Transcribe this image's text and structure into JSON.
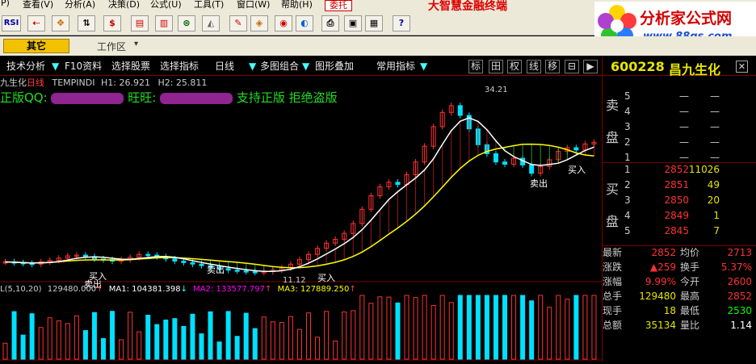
{
  "menu": {
    "items": [
      "P)",
      "查看(V)",
      "分析(A)",
      "决策(D)",
      "公式(U)",
      "工具(T)",
      "窗口(W)",
      "帮助(H)"
    ],
    "trust": "委托",
    "brand": "大智慧金融终端"
  },
  "logo": {
    "title": "分析家公式网",
    "url": "www.88gs.com"
  },
  "toolbar": {
    "rsi": "RSI",
    "dollar": "$"
  },
  "tabstrip": {
    "other": "其它",
    "workspace": "工作区"
  },
  "chart_toolbar": {
    "items": [
      "技术分析",
      "F10资料",
      "选择股票",
      "选择指标",
      "日线",
      "多图组合",
      "图形叠加",
      "常用指标"
    ],
    "toggles": [
      "标",
      "田",
      "权",
      "线",
      "移",
      "⊟",
      "▶"
    ]
  },
  "price_chart": {
    "name": "九生化",
    "period": "日线",
    "indicator": "TEMPINDI",
    "h1": "H1: 26.921",
    "h2": "H2: 25.811",
    "watermark": "正版QQ:",
    "wangwang": "旺旺:",
    "slogan": "支持正版 拒绝盗版",
    "peak_label": "34.21",
    "low_label": "11.12",
    "signals": {
      "buy": "买入",
      "sell": "卖出"
    }
  },
  "volume_chart": {
    "label": "L(5,10,20)",
    "vol": "129480.000",
    "ma1": "MA1: 104381.398",
    "ma2": "MA2: 133577.797",
    "ma3": "MA3: 127889.250"
  },
  "colors": {
    "up": "#ff3232",
    "down": "#00e0ff",
    "ma_white": "#ffffff",
    "ma_yellow": "#ffff00",
    "green": "#00ff00",
    "panel_border": "#7a0000"
  },
  "stock": {
    "code": "600228",
    "name": "昌九生化"
  },
  "order_book": {
    "sell_label": [
      "卖",
      "盘"
    ],
    "buy_label": [
      "买",
      "盘"
    ],
    "sell": [
      {
        "n": "5",
        "p": "—",
        "v": "—"
      },
      {
        "n": "4",
        "p": "—",
        "v": "—"
      },
      {
        "n": "3",
        "p": "—",
        "v": "—"
      },
      {
        "n": "2",
        "p": "—",
        "v": "—"
      },
      {
        "n": "1",
        "p": "—",
        "v": "—"
      }
    ],
    "buy": [
      {
        "n": "1",
        "p": "2852",
        "v": "11026"
      },
      {
        "n": "2",
        "p": "2851",
        "v": "49"
      },
      {
        "n": "3",
        "p": "2850",
        "v": "20"
      },
      {
        "n": "4",
        "p": "2849",
        "v": "1"
      },
      {
        "n": "5",
        "p": "2845",
        "v": "7"
      }
    ]
  },
  "quote": [
    {
      "k1": "最新",
      "v1": "2852",
      "k2": "均价",
      "v2": "2713"
    },
    {
      "k1": "涨跌",
      "v1": "▲259",
      "k2": "换手",
      "v2": "5.37%"
    },
    {
      "k1": "涨幅",
      "v1": "9.99%",
      "k2": "今开",
      "v2": "2600"
    },
    {
      "k1": "总手",
      "v1": "129480",
      "k2": "最高",
      "v2": "2852"
    },
    {
      "k1": "现手",
      "v1": "18",
      "k2": "最低",
      "v2": "2530"
    },
    {
      "k1": "总额",
      "v1": "35134",
      "k2": "量比",
      "v2": "1.14"
    }
  ],
  "quote_colors": [
    [
      "#ff3232",
      "#ff3232"
    ],
    [
      "#ff3232",
      "#ff3232"
    ],
    [
      "#ff3232",
      "#ff3232"
    ],
    [
      "#e6e600",
      "#ff3232"
    ],
    [
      "#e6e600",
      "#00ff00"
    ],
    [
      "#e6e600",
      "#ffffff"
    ]
  ],
  "chart_data": {
    "type": "candlestick",
    "price_peak": 34.21,
    "price_low": 11.12,
    "close_series": [
      12.6,
      12.5,
      12.4,
      12.3,
      12.6,
      12.8,
      13.1,
      13.4,
      13.5,
      13.3,
      13.0,
      12.9,
      12.7,
      12.9,
      13.2,
      13.6,
      13.5,
      13.3,
      13.0,
      12.7,
      12.5,
      12.3,
      12.1,
      11.9,
      11.7,
      11.5,
      11.4,
      11.3,
      11.2,
      11.3,
      11.5,
      11.8,
      12.3,
      12.9,
      13.6,
      14.4,
      15.1,
      15.6,
      16.4,
      17.7,
      19.6,
      21.4,
      22.6,
      23.2,
      22.9,
      24.2,
      25.9,
      28.0,
      30.6,
      32.5,
      33.4,
      32.1,
      30.3,
      28.2,
      27.0,
      25.9,
      25.6,
      26.4,
      25.5,
      24.4,
      25.3,
      26.2,
      27.3,
      27.8,
      27.5,
      28.3,
      28.52
    ]
  }
}
